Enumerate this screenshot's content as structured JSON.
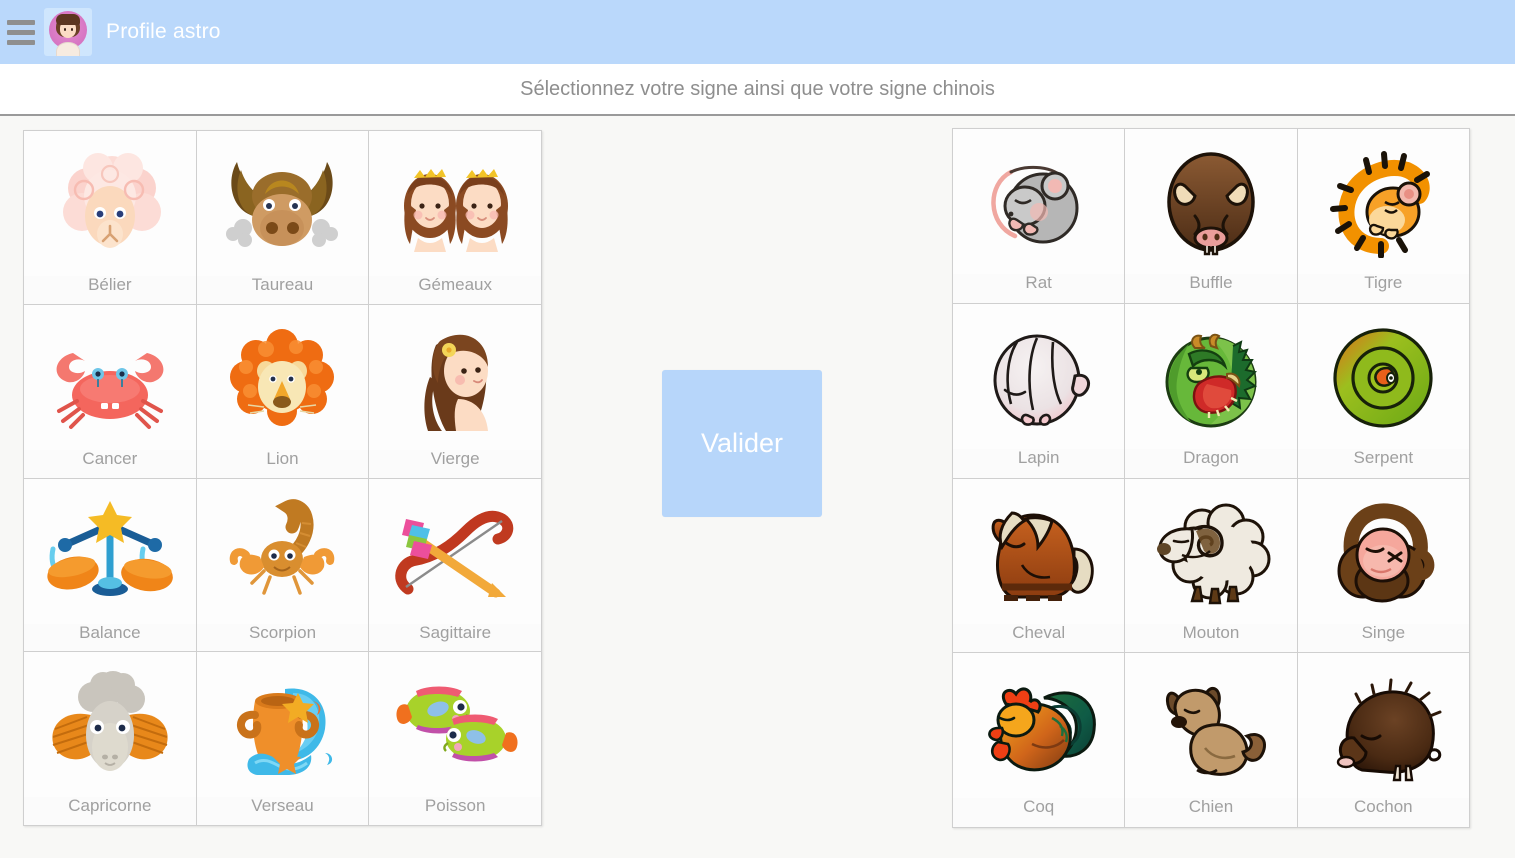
{
  "header": {
    "title": "Profile astro",
    "menu_icon": "hamburger-menu-icon",
    "avatar_icon": "user-avatar",
    "background_color": "#bad8fb"
  },
  "subtitle": "Sélectionnez votre signe ainsi que votre signe chinois",
  "validate_button": {
    "label": "Valider",
    "color": "#b7d6fa",
    "text_color": "#ffffff"
  },
  "western_zodiac": {
    "signs": [
      {
        "label": "Bélier",
        "icon": "sheep-ram-icon"
      },
      {
        "label": "Taureau",
        "icon": "bull-icon"
      },
      {
        "label": "Gémeaux",
        "icon": "twin-girls-icon"
      },
      {
        "label": "Cancer",
        "icon": "crab-icon"
      },
      {
        "label": "Lion",
        "icon": "lion-icon"
      },
      {
        "label": "Vierge",
        "icon": "maiden-icon"
      },
      {
        "label": "Balance",
        "icon": "scales-icon"
      },
      {
        "label": "Scorpion",
        "icon": "scorpion-icon"
      },
      {
        "label": "Sagittaire",
        "icon": "bow-arrow-icon"
      },
      {
        "label": "Capricorne",
        "icon": "goat-icon"
      },
      {
        "label": "Verseau",
        "icon": "water-jug-icon"
      },
      {
        "label": "Poisson",
        "icon": "two-fish-icon"
      }
    ]
  },
  "chinese_zodiac": {
    "signs": [
      {
        "label": "Rat",
        "icon": "rat-icon"
      },
      {
        "label": "Buffle",
        "icon": "buffalo-icon"
      },
      {
        "label": "Tigre",
        "icon": "tiger-icon"
      },
      {
        "label": "Lapin",
        "icon": "rabbit-icon"
      },
      {
        "label": "Dragon",
        "icon": "dragon-icon"
      },
      {
        "label": "Serpent",
        "icon": "snake-icon"
      },
      {
        "label": "Cheval",
        "icon": "horse-icon"
      },
      {
        "label": "Mouton",
        "icon": "sheep-icon"
      },
      {
        "label": "Singe",
        "icon": "monkey-icon"
      },
      {
        "label": "Coq",
        "icon": "rooster-icon"
      },
      {
        "label": "Chien",
        "icon": "dog-icon"
      },
      {
        "label": "Cochon",
        "icon": "pig-icon"
      }
    ]
  }
}
